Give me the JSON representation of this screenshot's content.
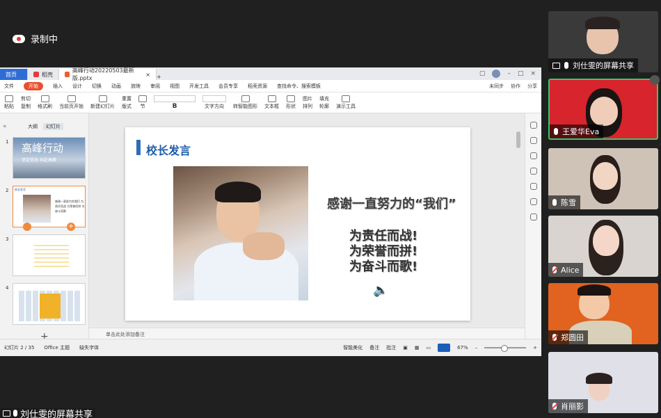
{
  "recording": {
    "label": "录制中"
  },
  "window": {
    "tabs": [
      {
        "label": "首页"
      },
      {
        "label": "稻壳"
      },
      {
        "label": "高峰行动20220503最新版.pptx"
      }
    ],
    "menu": [
      "文件",
      "开始",
      "插入",
      "设计",
      "切换",
      "动画",
      "放映",
      "审阅",
      "视图",
      "开发工具",
      "会员专享",
      "稻壳资源"
    ],
    "search_hint": "查找命令、搜索模板",
    "menu_right": [
      "未同步",
      "协作",
      "分享"
    ],
    "toolbar": {
      "paste": "粘贴",
      "cut": "剪切",
      "copy": "复制",
      "format_painter": "格式刷",
      "from_current": "当前页开始",
      "new_slide": "新建幻灯片",
      "layout": "版式",
      "section": "节",
      "reset": "重置",
      "textbox": "文本框",
      "shape": "形状",
      "arrange": "排列",
      "picture": "图片",
      "fill": "填充",
      "outline": "轮廓",
      "present_tools": "演示工具",
      "convert_smartart": "转智能图形",
      "text_direction": "文字方向"
    },
    "panel_tabs": [
      "大纲",
      "幻灯片"
    ],
    "slide_numbers": [
      "1",
      "2",
      "3",
      "4"
    ],
    "thumb1": {
      "title": "高峰行动",
      "subtitle": "坚定信念 共赴高峰"
    },
    "thumb2": {
      "header": "校长发言",
      "text": "感谢一直努力的我们 为责任而战 为荣誉而拼 为奋斗而歌"
    },
    "slide": {
      "title": "校长发言",
      "thanks": "感谢一直努力的“我们”",
      "motto": [
        "为责任而战!",
        "为荣誉而拼!",
        "为奋斗而歌!"
      ]
    },
    "notes_placeholder": "单击此处添加备注",
    "status": {
      "slide_count": "幻灯片 2 / 35",
      "theme": "Office 主题",
      "missing_font": "缺失字体",
      "smart_beautify": "智能美化",
      "notes": "备注",
      "comments": "批注",
      "zoom": "67%"
    }
  },
  "share_label": "刘仕雯的屏幕共享",
  "participants": [
    {
      "name": "刘仕雯的屏幕共享",
      "muted": false,
      "speaking": false
    },
    {
      "name": "王爱华Eva",
      "muted": false,
      "speaking": true
    },
    {
      "name": "陈雪",
      "muted": false,
      "speaking": false
    },
    {
      "name": "Alice",
      "muted": true,
      "speaking": false
    },
    {
      "name": "郑圆田",
      "muted": true,
      "speaking": false
    },
    {
      "name": "肖丽影",
      "muted": true,
      "speaking": false
    }
  ],
  "colors": {
    "accent_blue": "#2d6fb6",
    "speaking_green": "#3cc66a",
    "wps_orange": "#e8502f"
  }
}
